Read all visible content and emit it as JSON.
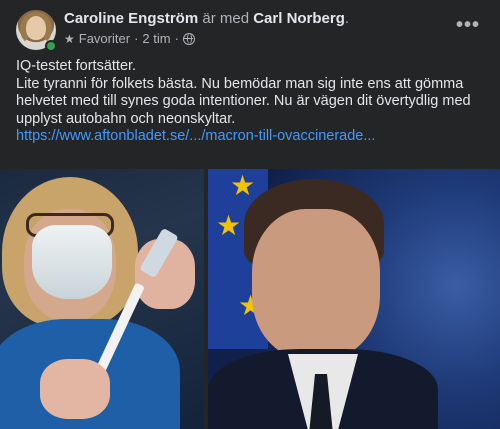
{
  "post": {
    "author": "Caroline Engström",
    "with_text": " är med ",
    "tagged": "Carl Norberg",
    "period": ".",
    "audience": "Favoriter",
    "separator": "·",
    "time": "2 tim",
    "separator2": "·",
    "more_label": "•••",
    "text_line1": "IQ-testet fortsätter.",
    "text_line2": "Lite tyranni för folkets bästa. Nu bemödar man sig inte ens att  gömma helvetet med till synes goda intentioner. Nu är vägen dit övertydlig med upplyst autobahn och neonskyltar.",
    "link": "https://www.aftonbladet.se/.../macron-till-ovaccinerade..."
  },
  "icons": {
    "star": "star-icon",
    "globe": "globe-icon",
    "more": "more-options-icon"
  },
  "colors": {
    "background": "#242526",
    "link": "#4599ff",
    "online": "#31a24c",
    "secondary_text": "#b0b3b8"
  }
}
